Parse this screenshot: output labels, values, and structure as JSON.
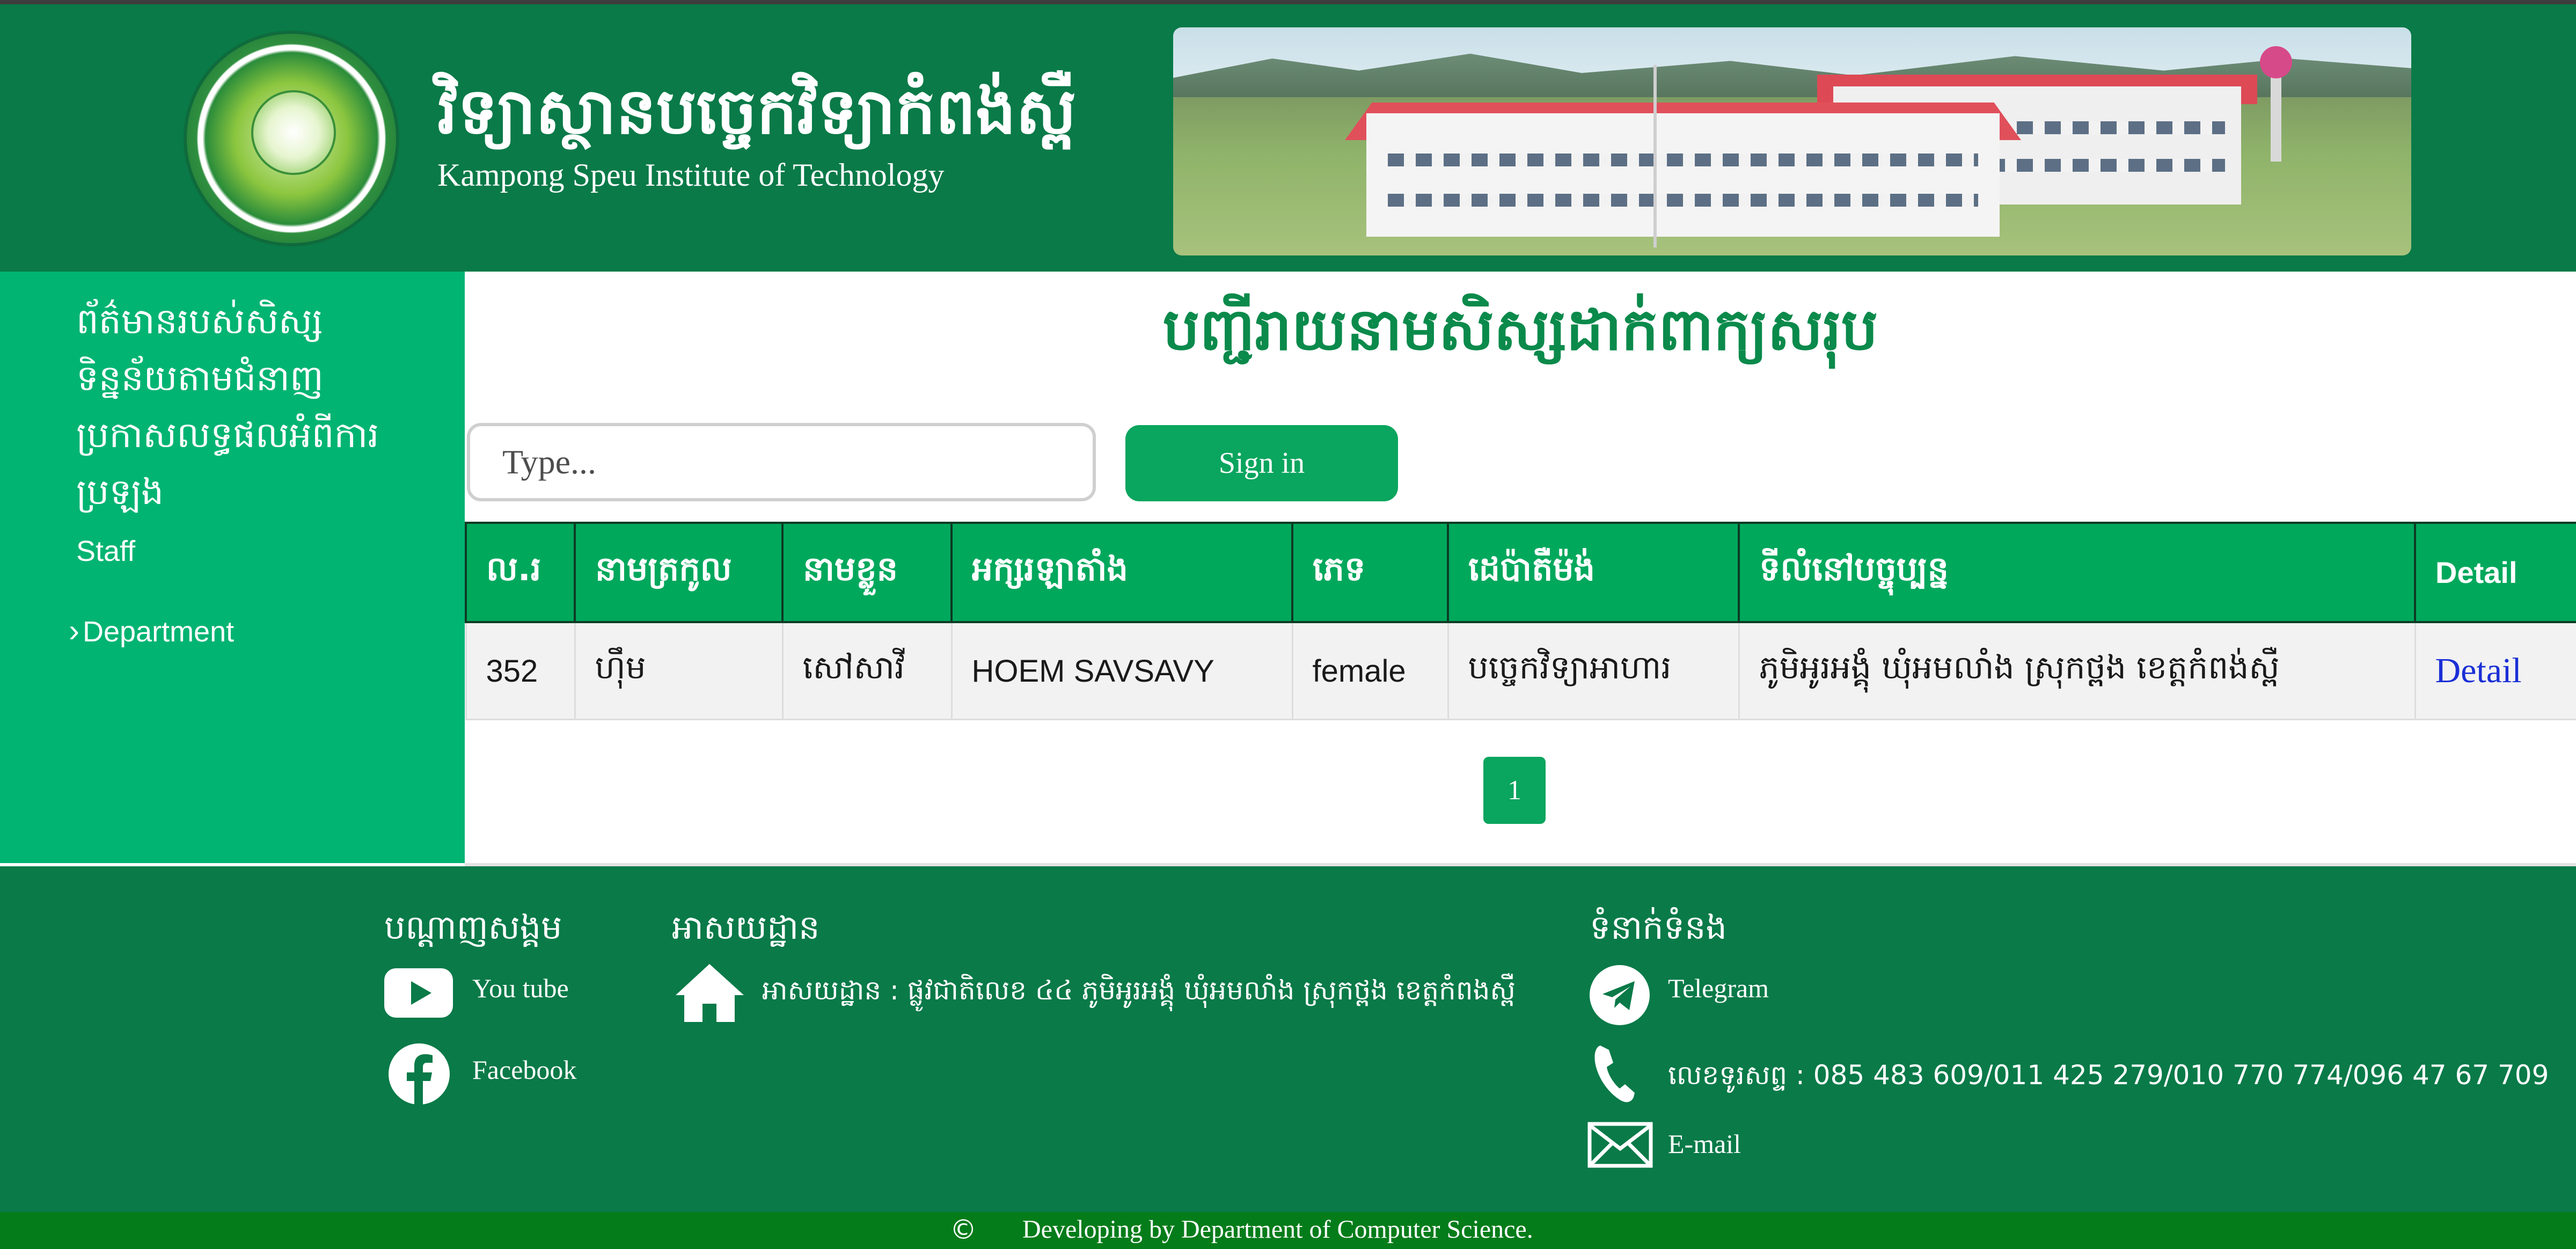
{
  "header": {
    "title_kh": "វិទ្យាស្ថានបច្ចេកវិទ្យាកំពង់ស្ពឺ",
    "title_en": "Kampong Speu Institute of Technology"
  },
  "sidebar": {
    "items": [
      {
        "label": "ព័ត៌មានរបស់សិស្ស"
      },
      {
        "label": "ទិន្នន័យតាមជំនាញ"
      },
      {
        "label": "ប្រកាសលទ្ធផលអំពីការ"
      },
      {
        "label": "ប្រឡង"
      },
      {
        "label": "Staff"
      },
      {
        "label": "Department"
      }
    ]
  },
  "main": {
    "title": "បញ្ជីរាយនាមសិស្សដាក់ពាក្យសរុប",
    "search_placeholder": "Type...",
    "search_button": "Sign in",
    "table": {
      "headers": [
        "ល.រ",
        "នាមត្រកូល",
        "នាមខ្លួន",
        "អក្សរឡាតាំង",
        "ភេទ",
        "ដេប៉ាតឺម៉ង់",
        "ទីលំនៅបច្ចុប្បន្ន",
        "Detail"
      ],
      "rows": [
        [
          "352",
          "ហ៊ឹម",
          "សៅសាវី",
          "HOEM SAVSAVY",
          "female",
          "បច្ចេកវិទ្យាអាហារ",
          "ភូមិអូរអង្គុំ ឃុំអមលាំង ស្រុកថ្ពង ខេត្តកំពង់ស្ពឺ",
          "Detail"
        ]
      ]
    },
    "pagination": {
      "current": "1"
    }
  },
  "footer": {
    "social": {
      "heading": "បណ្ដាញសង្គម",
      "youtube": "You tube",
      "facebook": "Facebook"
    },
    "address": {
      "heading": "អាសយដ្ឋាន",
      "text": "អាសយដ្ឋាន : ផ្លូវជាតិលេខ ៤៤ ភូមិអូរអង្គុំ ឃុំអមលាំង ស្រុកថ្ពង ខេត្តកំពងស្ពឺ"
    },
    "contact": {
      "heading": "ទំនាក់ទំនង",
      "telegram": "Telegram",
      "phone": "លេខទូរសព្ទ : 085 483 609/011 425 279/010 770 774/096 47 67 709",
      "email": "E-mail"
    },
    "copyright_symbol": "©",
    "copyright_text": "Developing by Department of Computer Science."
  },
  "colors": {
    "header_green": "#097a48",
    "sidebar_green": "#01b472",
    "table_header": "#00a85c",
    "button_green": "#0aa55e",
    "copyright_bar": "#057c1a",
    "link_blue": "#1a2fd6"
  },
  "icons": [
    "institute-logo",
    "campus-banner-image",
    "chevron-right-icon",
    "youtube-icon",
    "facebook-icon",
    "home-icon",
    "telegram-icon",
    "phone-icon",
    "email-icon"
  ]
}
